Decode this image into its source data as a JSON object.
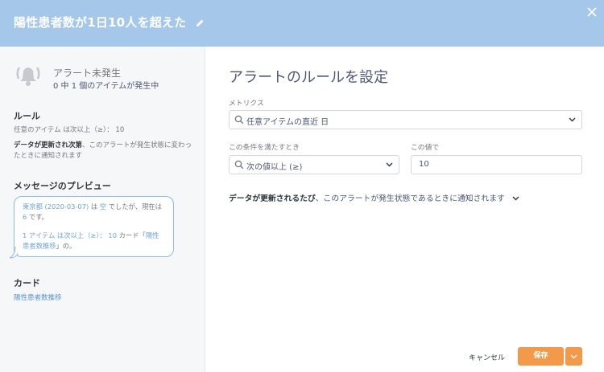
{
  "header": {
    "title": "陽性患者数が1日10人を超えた",
    "bg_color": "#a5c8ea"
  },
  "sidebar": {
    "alert_state": "アラート未発生",
    "alert_count": "0 中 1 個のアイテムが発生中",
    "rule_heading": "ルール",
    "rule_text": "任意のアイテム は次以上（≥）： 10",
    "rule_desc_bold": "データが更新され次第",
    "rule_desc_rest": "、このアラートが発生状態に変わったときに通知されます",
    "preview_heading": "メッセージのプレビュー",
    "preview": {
      "l1_a": "東京都 (2020-03-07)",
      "l1_b": " は ",
      "l1_c": "空",
      "l1_d": " でしたが、現在は ",
      "l1_e": "6",
      "l1_f": " です。",
      "l2_a": "1 アイテム は次以上（≥）： 10",
      "l2_b": " カード「",
      "l2_c": "陽性患者数推移",
      "l2_d": "」の。"
    },
    "card_heading": "カード",
    "card_link": "陽性患者数推移"
  },
  "main": {
    "title": "アラートのルールを設定",
    "metrics_label": "メトリクス",
    "metrics_value": "任意アイテムの直近 日",
    "condition_label": "この条件を満たすとき",
    "condition_value": "次の値以上 (≥)",
    "value_label": "この値で",
    "value": "10",
    "notify_bold": "データが更新されるたび",
    "notify_rest": "、このアラートが発生状態であるときに通知されます"
  },
  "footer": {
    "cancel_label": "キャンセル",
    "save_label": "保存",
    "accent_color": "#f2994a"
  },
  "icons": [
    "pencil-icon",
    "close-icon",
    "bell-icon",
    "search-icon",
    "chevron-down-icon"
  ]
}
